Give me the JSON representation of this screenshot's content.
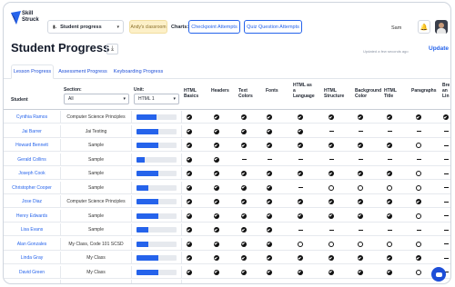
{
  "app": {
    "logo_line1": "Skill",
    "logo_line2": "Struck",
    "course_select": "Student progress",
    "classroom": "Andy's classroom",
    "charts_label": "Charts:",
    "chart_buttons": [
      "Checkpoint Attempts",
      "Quiz Question Attempts"
    ],
    "user_name": "Sam"
  },
  "page": {
    "title": "Student Progress",
    "updated_text": "Updated a few seconds ago",
    "update_link": "Update"
  },
  "tabs": [
    {
      "label": "Lesson Progress",
      "active": true
    },
    {
      "label": "Assessment Progress",
      "active": false
    },
    {
      "label": "Keyboarding Progress",
      "active": false
    }
  ],
  "filters": {
    "student_header": "Student",
    "section_label": "Section:",
    "section_value": "All",
    "unit_label": "Unit:",
    "unit_value": "HTML 1"
  },
  "columns": [
    [
      "HTML",
      "Basics"
    ],
    [
      "Headers"
    ],
    [
      "Text",
      "Colors"
    ],
    [
      "Fonts"
    ],
    [
      "HTML as",
      "a",
      "Language"
    ],
    [
      "HTML",
      "Structure"
    ],
    [
      "Background",
      "Color"
    ],
    [
      "HTML",
      "Title"
    ],
    [
      "Paragraphs"
    ],
    [
      "Bre",
      "an",
      "Lin"
    ]
  ],
  "rows": [
    {
      "student": "Cynthia Ramos",
      "section": "Computer Science Principles",
      "progress": 0.5,
      "marks": [
        "c",
        "c",
        "c",
        "c",
        "c",
        "c",
        "c",
        "c",
        "c",
        "c"
      ]
    },
    {
      "student": "Jai Barrer",
      "section": "Jai Testing",
      "progress": 0.55,
      "marks": [
        "c",
        "c",
        "c",
        "c",
        "c",
        "d",
        "d",
        "d",
        "d",
        "d"
      ]
    },
    {
      "student": "Howard Bennett",
      "section": "Sample",
      "progress": 0.55,
      "marks": [
        "c",
        "c",
        "c",
        "c",
        "c",
        "c",
        "c",
        "c",
        "o",
        "d"
      ]
    },
    {
      "student": "Gerald Collins",
      "section": "Sample",
      "progress": 0.2,
      "marks": [
        "c",
        "c",
        "d",
        "d",
        "d",
        "d",
        "d",
        "d",
        "d",
        "d"
      ]
    },
    {
      "student": "Joseph Cook",
      "section": "Sample",
      "progress": 0.55,
      "marks": [
        "c",
        "c",
        "c",
        "c",
        "c",
        "c",
        "c",
        "c",
        "o",
        "d"
      ]
    },
    {
      "student": "Christopher Cooper",
      "section": "Sample",
      "progress": 0.3,
      "marks": [
        "c",
        "c",
        "c",
        "c",
        "d",
        "o",
        "o",
        "o",
        "o",
        "d"
      ]
    },
    {
      "student": "Jose Diaz",
      "section": "Computer Science Principles",
      "progress": 0.55,
      "marks": [
        "c",
        "c",
        "c",
        "c",
        "c",
        "c",
        "c",
        "c",
        "c",
        "d"
      ]
    },
    {
      "student": "Henry Edwards",
      "section": "Sample",
      "progress": 0.55,
      "marks": [
        "c",
        "c",
        "c",
        "c",
        "c",
        "c",
        "c",
        "c",
        "o",
        "d"
      ]
    },
    {
      "student": "Lisa Evans",
      "section": "Sample",
      "progress": 0.3,
      "marks": [
        "c",
        "c",
        "c",
        "c",
        "d",
        "d",
        "d",
        "d",
        "d",
        "d"
      ]
    },
    {
      "student": "Alan Gonzales",
      "section": "My Class, Code 101 SCSD",
      "progress": 0.3,
      "marks": [
        "c",
        "c",
        "c",
        "c",
        "o",
        "o",
        "o",
        "o",
        "o",
        "d"
      ]
    },
    {
      "student": "Linda Gray",
      "section": "My Class",
      "progress": 0.55,
      "marks": [
        "c",
        "c",
        "c",
        "c",
        "c",
        "c",
        "c",
        "c",
        "c",
        "d"
      ]
    },
    {
      "student": "David Green",
      "section": "My Class",
      "progress": 0.55,
      "marks": [
        "c",
        "c",
        "c",
        "c",
        "c",
        "c",
        "c",
        "c",
        "o",
        "d"
      ]
    },
    {
      "student": "",
      "section": "",
      "progress": 0.55,
      "marks": [
        "c",
        "c",
        "c",
        "c",
        "c",
        "c",
        "c",
        "c",
        "c",
        "d"
      ]
    }
  ],
  "colors": {
    "accent": "#2563eb",
    "classroom_bg": "#fdf0c8"
  }
}
